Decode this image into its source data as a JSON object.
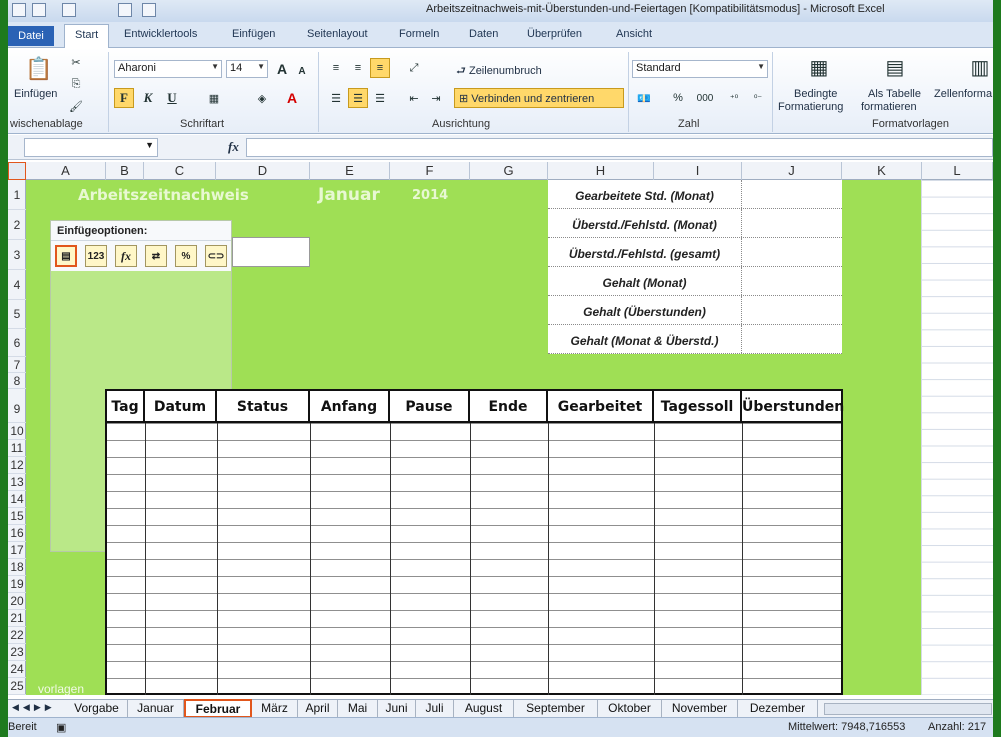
{
  "window": {
    "title": "Arbeitszeitnachweis-mit-Überstunden-und-Feiertagen  [Kompatibilitätsmodus]  -  Microsoft Excel"
  },
  "ribbon_tabs": [
    "Datei",
    "Start",
    "Entwicklertools",
    "Einfügen",
    "Seitenlayout",
    "Formeln",
    "Daten",
    "Überprüfen",
    "Ansicht"
  ],
  "active_ribbon_tab": "Start",
  "ribbon": {
    "clipboard": {
      "paste_label": "Einfügen",
      "group_label": "wischenablage"
    },
    "font": {
      "name": "Aharoni",
      "size": "14",
      "bold": "F",
      "italic": "K",
      "underline": "U",
      "group_label": "Schriftart"
    },
    "alignment": {
      "wrap_label": "Zeilenumbruch",
      "merge_label": "Verbinden und zentrieren",
      "group_label": "Ausrichtung"
    },
    "number": {
      "format": "Standard",
      "percent": "%",
      "thousands": "000",
      "group_label": "Zahl"
    },
    "styles": {
      "conditional_label_1": "Bedingte",
      "conditional_label_2": "Formatierung",
      "table_label_1": "Als Tabelle",
      "table_label_2": "formatieren",
      "cell_label_1": "Zellenforma",
      "group_label": "Formatvorlagen"
    }
  },
  "formula_bar": {
    "fx": "fx",
    "value": ""
  },
  "columns": [
    "A",
    "B",
    "C",
    "D",
    "E",
    "F",
    "G",
    "H",
    "I",
    "J",
    "K",
    "L"
  ],
  "rows": [
    "1",
    "2",
    "3",
    "4",
    "5",
    "6",
    "7",
    "8",
    "9",
    "10",
    "11",
    "12",
    "13",
    "14",
    "15",
    "16",
    "17",
    "18",
    "19",
    "20",
    "21",
    "22",
    "23",
    "24",
    "25"
  ],
  "sheet": {
    "title": "Arbeitszeitnachweis",
    "month": "Januar",
    "year": "2014",
    "summary_labels": [
      "Gearbeitete Std. (Monat)",
      "Überstd./Fehlstd. (Monat)",
      "Überstd./Fehlstd. (gesamt)",
      "Gehalt (Monat)",
      "Gehalt (Überstunden)",
      "Gehalt (Monat & Überstd.)"
    ],
    "table_headers": [
      "Tag",
      "Datum",
      "Status",
      "Anfang",
      "Pause",
      "Ende",
      "Gearbeitet",
      "Tagessoll",
      "Überstunden"
    ]
  },
  "paste_options": {
    "title": "Einfügeoptionen:",
    "buttons": [
      "paste-icon",
      "values-icon",
      "formulas-icon",
      "transpose-icon",
      "formatting-icon",
      "link-icon"
    ]
  },
  "sheet_tabs": [
    "Vorgabe",
    "Januar",
    "Februar",
    "März",
    "April",
    "Mai",
    "Juni",
    "Juli",
    "August",
    "September",
    "Oktober",
    "November",
    "Dezember"
  ],
  "active_sheet": "Februar",
  "status": {
    "mode": "Bereit",
    "average": "Mittelwert: 7948,716553",
    "count": "Anzahl: 217"
  },
  "watermark": "vorlagen",
  "colors": {
    "sheet_green": "#9fdf55",
    "frame_green": "#1e7a1e",
    "active_tab_border": "#e1561c"
  }
}
